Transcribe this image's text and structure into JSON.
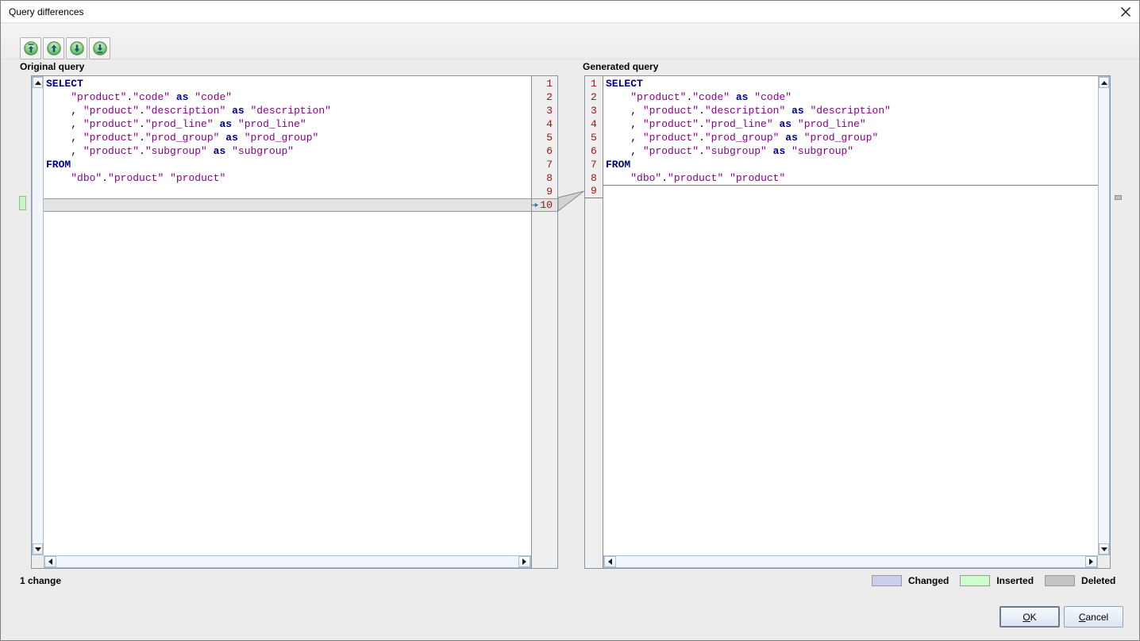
{
  "window": {
    "title": "Query differences"
  },
  "toolbar": {
    "buttons": [
      {
        "icon": "first-change-icon",
        "name": "go-to-first-change"
      },
      {
        "icon": "previous-change-icon",
        "name": "go-to-previous-change"
      },
      {
        "icon": "next-change-icon",
        "name": "go-to-next-change"
      },
      {
        "icon": "last-change-icon",
        "name": "go-to-last-change"
      }
    ]
  },
  "panes": {
    "left": {
      "label": "Original query",
      "line_numbers": [
        "1",
        "2",
        "3",
        "4",
        "5",
        "6",
        "7",
        "8",
        "9",
        "10"
      ]
    },
    "right": {
      "label": "Generated query",
      "line_numbers": [
        "1",
        "2",
        "3",
        "4",
        "5",
        "6",
        "7",
        "8",
        "9"
      ]
    }
  },
  "sql": {
    "lines": [
      [
        [
          "kw",
          "SELECT"
        ]
      ],
      [
        [
          "pl",
          "    "
        ],
        [
          "id",
          "\"product\""
        ],
        [
          "pl",
          "."
        ],
        [
          "id",
          "\"code\""
        ],
        [
          "pl",
          " "
        ],
        [
          "kw",
          "as"
        ],
        [
          "pl",
          " "
        ],
        [
          "id",
          "\"code\""
        ]
      ],
      [
        [
          "pl",
          "    , "
        ],
        [
          "id",
          "\"product\""
        ],
        [
          "pl",
          "."
        ],
        [
          "id",
          "\"description\""
        ],
        [
          "pl",
          " "
        ],
        [
          "kw",
          "as"
        ],
        [
          "pl",
          " "
        ],
        [
          "id",
          "\"description\""
        ]
      ],
      [
        [
          "pl",
          "    , "
        ],
        [
          "id",
          "\"product\""
        ],
        [
          "pl",
          "."
        ],
        [
          "id",
          "\"prod_line\""
        ],
        [
          "pl",
          " "
        ],
        [
          "kw",
          "as"
        ],
        [
          "pl",
          " "
        ],
        [
          "id",
          "\"prod_line\""
        ]
      ],
      [
        [
          "pl",
          "    , "
        ],
        [
          "id",
          "\"product\""
        ],
        [
          "pl",
          "."
        ],
        [
          "id",
          "\"prod_group\""
        ],
        [
          "pl",
          " "
        ],
        [
          "kw",
          "as"
        ],
        [
          "pl",
          " "
        ],
        [
          "id",
          "\"prod_group\""
        ]
      ],
      [
        [
          "pl",
          "    , "
        ],
        [
          "id",
          "\"product\""
        ],
        [
          "pl",
          "."
        ],
        [
          "id",
          "\"subgroup\""
        ],
        [
          "pl",
          " "
        ],
        [
          "kw",
          "as"
        ],
        [
          "pl",
          " "
        ],
        [
          "id",
          "\"subgroup\""
        ]
      ],
      [
        [
          "kw",
          "FROM"
        ]
      ],
      [
        [
          "pl",
          "    "
        ],
        [
          "id",
          "\"dbo\""
        ],
        [
          "pl",
          "."
        ],
        [
          "id",
          "\"product\""
        ],
        [
          "pl",
          " "
        ],
        [
          "id",
          "\"product\""
        ]
      ],
      []
    ]
  },
  "diff": {
    "left_highlighted_line": 10,
    "right_marker_after_line": 8,
    "change_count_label": "1 change"
  },
  "legend": [
    {
      "label": "Changed",
      "color": "#ccccee"
    },
    {
      "label": "Inserted",
      "color": "#ccffcc"
    },
    {
      "label": "Deleted",
      "color": "#c3c3c3"
    }
  ],
  "buttons": {
    "ok": {
      "key": "O",
      "rest": "K"
    },
    "cancel": {
      "key": "C",
      "rest": "ancel"
    }
  },
  "colors": {
    "keyword": "#00008b",
    "identifier": "#8b008b",
    "line_number": "#991111",
    "highlight_row": "#e3e3e3",
    "inserted_marker": "#c8f6c8",
    "deleted_marker": "#bfbfbf"
  }
}
